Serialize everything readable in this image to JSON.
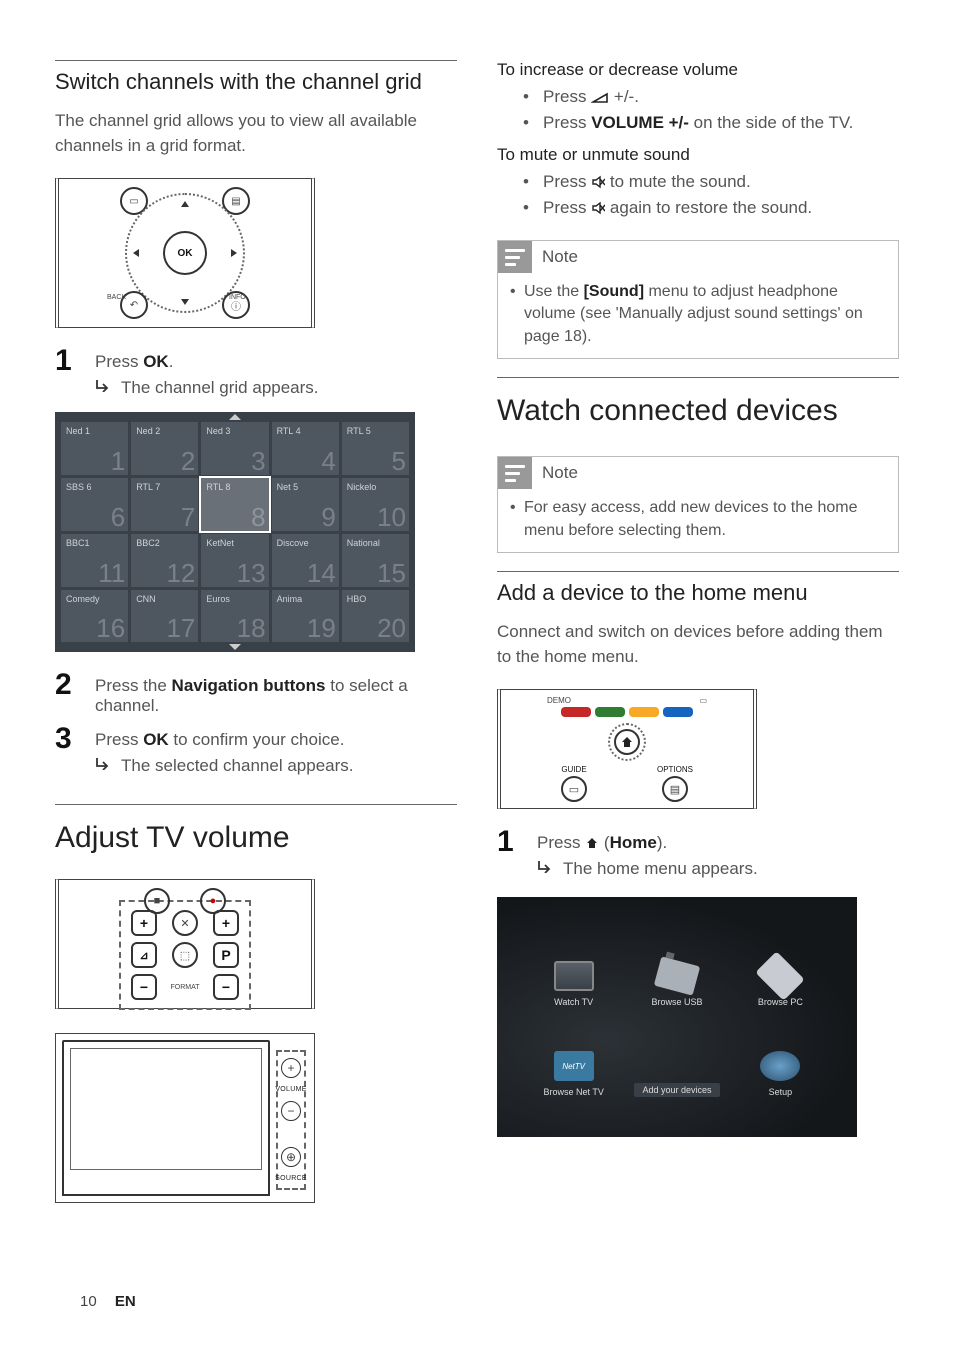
{
  "footer": {
    "page": "10",
    "lang": "EN"
  },
  "left": {
    "h3_grid": "Switch channels with the channel grid",
    "grid_intro": "The channel grid allows you to view all available channels in a grid format.",
    "remote_ok": "OK",
    "remote_back": "BACK",
    "remote_info": "INFO",
    "step1_text_a": "Press ",
    "step1_ok": "OK",
    "step1_text_b": ".",
    "step1_result": "The channel grid appears.",
    "channels": [
      {
        "n": "Ned 1",
        "i": "1"
      },
      {
        "n": "Ned 2",
        "i": "2"
      },
      {
        "n": "Ned 3",
        "i": "3"
      },
      {
        "n": "RTL 4",
        "i": "4"
      },
      {
        "n": "RTL 5",
        "i": "5"
      },
      {
        "n": "SBS 6",
        "i": "6"
      },
      {
        "n": "RTL 7",
        "i": "7"
      },
      {
        "n": "RTL 8",
        "i": "8",
        "sel": true
      },
      {
        "n": "Net 5",
        "i": "9"
      },
      {
        "n": "Nickelo",
        "i": "10"
      },
      {
        "n": "BBC1",
        "i": "11"
      },
      {
        "n": "BBC2",
        "i": "12"
      },
      {
        "n": "KetNet",
        "i": "13"
      },
      {
        "n": "Discove",
        "i": "14"
      },
      {
        "n": "National",
        "i": "15"
      },
      {
        "n": "Comedy",
        "i": "16"
      },
      {
        "n": "CNN",
        "i": "17"
      },
      {
        "n": "Euros",
        "i": "18"
      },
      {
        "n": "Anima",
        "i": "19"
      },
      {
        "n": "HBO",
        "i": "20"
      }
    ],
    "step2_a": "Press the ",
    "step2_nav": "Navigation buttons",
    "step2_b": " to select a channel.",
    "step3_a": "Press ",
    "step3_ok": "OK",
    "step3_b": " to confirm your choice.",
    "step3_result": "The selected channel appears.",
    "h2_volume": "Adjust TV volume",
    "remote2_format": "FORMAT",
    "tv_volume_label": "VOLUME",
    "tv_source_label": "SOURCE"
  },
  "right": {
    "sub_incdec": "To increase or decrease volume",
    "b1_a": "Press ",
    "b1_b": " +/-.",
    "b2_a": "Press ",
    "b2_vol": "VOLUME +/-",
    "b2_b": " on the side of the TV.",
    "sub_mute": "To mute or unmute sound",
    "b3_a": "Press ",
    "b3_b": " to mute the sound.",
    "b4_a": "Press ",
    "b4_b": " again to restore the sound.",
    "note1_title": "Note",
    "note1_body_a": "Use the ",
    "note1_sound": "[Sound]",
    "note1_body_b": " menu to adjust headphone volume (see 'Manually adjust sound settings' on page 18).",
    "h2_watch": "Watch connected devices",
    "note2_title": "Note",
    "note2_body": "For easy access, add new devices to the home menu before selecting them.",
    "h3_add": "Add a device to the home menu",
    "add_intro": "Connect and switch on devices before adding them to the home menu.",
    "remote3_demo": "DEMO",
    "remote3_guide": "GUIDE",
    "remote3_options": "OPTIONS",
    "step1_a": "Press ",
    "step1_home": "Home",
    "step1_b": ").",
    "step1_open": " (",
    "step1_result": "The home menu appears.",
    "tiles": {
      "watch": "Watch TV",
      "usb": "Browse USB",
      "pc": "Browse PC",
      "net": "Browse Net TV",
      "net_logo": "NetTV",
      "add": "Add your devices",
      "setup": "Setup"
    }
  },
  "nums": {
    "one": "1",
    "two": "2",
    "three": "3"
  }
}
